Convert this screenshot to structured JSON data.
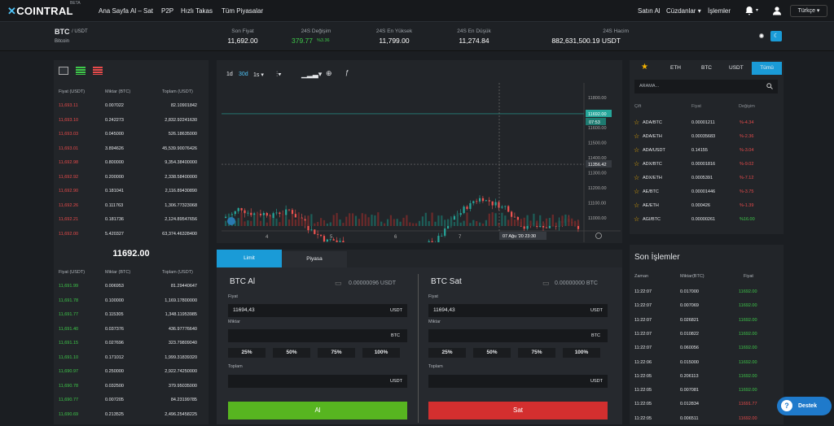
{
  "header": {
    "logo": "COINTRAL",
    "beta": "BETA",
    "nav": [
      "Ana Sayfa",
      "Al – Sat",
      "P2P",
      "Hızlı Takas",
      "Tüm Piyasalar"
    ],
    "right": {
      "sell": "Satın Al",
      "wallet": "Cüzdanlar",
      "trades": "İşlemler",
      "lang": "Türkçe"
    }
  },
  "ticker": {
    "pair": "BTC",
    "quote": "/ USDT",
    "name": "Bitcoin",
    "labels": [
      "Son Fiyat",
      "24S Değişim",
      "24S En Yüksek",
      "24S En Düşük",
      "24S Hacim"
    ],
    "last": "11,692.00",
    "change": "379.77",
    "change_pct": "%3.36",
    "high": "11,799.00",
    "low": "11,274.84",
    "volume": "882,631,500.19 USDT"
  },
  "orderbook": {
    "headers": [
      "Fiyat (USDT)",
      "Miktar (BTC)",
      "Toplam (USDT)"
    ],
    "asks": [
      [
        "11,693.11",
        "0.007022",
        "82.10901842"
      ],
      [
        "11,693.10",
        "0.242273",
        "2,832.92241630"
      ],
      [
        "11,693.03",
        "0.045000",
        "526.18635000"
      ],
      [
        "11,693.01",
        "3.894626",
        "45,539.90076426"
      ],
      [
        "11,692.98",
        "0.800000",
        "9,354.38400000"
      ],
      [
        "11,692.92",
        "0.200000",
        "2,338.58400000"
      ],
      [
        "11,692.90",
        "0.181041",
        "2,116.89430890"
      ],
      [
        "11,692.26",
        "0.111763",
        "1,306.77323068"
      ],
      [
        "11,692.21",
        "0.181736",
        "2,124.89547656"
      ],
      [
        "11,692.00",
        "5.420327",
        "63,374.46328400"
      ]
    ],
    "mid": "11692.00",
    "bids": [
      [
        "11,691.99",
        "0.006953",
        "81.29440647"
      ],
      [
        "11,691.78",
        "0.100000",
        "1,169.17800000"
      ],
      [
        "11,691.77",
        "0.115305",
        "1,348.11953985"
      ],
      [
        "11,691.40",
        "0.037376",
        "436.97776640"
      ],
      [
        "11,691.15",
        "0.027696",
        "323.79809040"
      ],
      [
        "11,691.10",
        "0.171012",
        "1,999.31839320"
      ],
      [
        "11,690.97",
        "0.250000",
        "2,922.74250000"
      ],
      [
        "11,690.78",
        "0.032500",
        "379.95035000"
      ],
      [
        "11,690.77",
        "0.007205",
        "84.23199785"
      ],
      [
        "11,690.69",
        "0.213525",
        "2,496.25458225"
      ]
    ]
  },
  "chart": {
    "intervals": [
      "1d",
      "30d",
      "1s"
    ],
    "price_ticks": [
      "11800.00",
      "11700.00",
      "11600.00",
      "11500.00",
      "11400.00",
      "11300.00",
      "11200.00",
      "11100.00",
      "11000.00"
    ],
    "last_price": "11692.00",
    "countdown": "07:53",
    "cross_price": "11356.42",
    "x_ticks": [
      "4",
      "5",
      "6",
      "7"
    ],
    "cross_date": "07 Ağu '20",
    "cross_time": "23:30"
  },
  "trade": {
    "tabs": [
      "Limit",
      "Piyasa"
    ],
    "buy": {
      "title": "BTC Al",
      "balance": "0.00000096 USDT",
      "price_label": "Fiyat",
      "price": "11694,43",
      "price_unit": "USDT",
      "amount_label": "Miktar",
      "amount_unit": "BTC",
      "total_label": "Toplam",
      "total_unit": "USDT",
      "button": "Al"
    },
    "sell": {
      "title": "BTC Sat",
      "balance": "0.00000000 BTC",
      "price_label": "Fiyat",
      "price": "11694,43",
      "price_unit": "USDT",
      "amount_label": "Miktar",
      "amount_unit": "BTC",
      "total_label": "Toplam",
      "total_unit": "USDT",
      "button": "Sat"
    },
    "pcts": [
      "25%",
      "50%",
      "75%",
      "100%"
    ]
  },
  "markets": {
    "tabs": [
      "ETH",
      "BTC",
      "USDT",
      "Tümü"
    ],
    "search": "ARAMA...",
    "headers": [
      "Çift",
      "Fiyat",
      "Değişim"
    ],
    "rows": [
      [
        "ADA/BTC",
        "0.00001211",
        "%-4.34",
        "red"
      ],
      [
        "ADA/ETH",
        "0.00035683",
        "%-2.36",
        "red"
      ],
      [
        "ADA/USDT",
        "0.14155",
        "%-3.04",
        "red"
      ],
      [
        "ADX/BTC",
        "0.00001816",
        "%-9.02",
        "red"
      ],
      [
        "ADX/ETH",
        "0.0005391",
        "%-7.12",
        "red"
      ],
      [
        "AE/BTC",
        "0.00001446",
        "%-3.75",
        "red"
      ],
      [
        "AE/ETH",
        "0.000426",
        "%-1.39",
        "red"
      ],
      [
        "AGI/BTC",
        "0.00000261",
        "%16.00",
        "green"
      ]
    ]
  },
  "trades": {
    "title": "Son İşlemler",
    "headers": [
      "Zaman",
      "Miktar(BTC)",
      "Fiyat"
    ],
    "rows": [
      [
        "11:22:07",
        "0.017000",
        "11692.00",
        "green"
      ],
      [
        "11:22:07",
        "0.007069",
        "11692.00",
        "green"
      ],
      [
        "11:22:07",
        "0.026821",
        "11692.00",
        "green"
      ],
      [
        "11:22:07",
        "0.010822",
        "11692.00",
        "green"
      ],
      [
        "11:22:07",
        "0.060056",
        "11692.00",
        "green"
      ],
      [
        "11:22:06",
        "0.015000",
        "11692.00",
        "green"
      ],
      [
        "11:22:05",
        "0.206113",
        "11692.00",
        "green"
      ],
      [
        "11:22:05",
        "0.007081",
        "11692.00",
        "green"
      ],
      [
        "11:22:05",
        "0.012834",
        "11691.77",
        "red"
      ],
      [
        "11:22:05",
        "0.006511",
        "11692.00",
        "red"
      ]
    ]
  },
  "support": "Destek"
}
